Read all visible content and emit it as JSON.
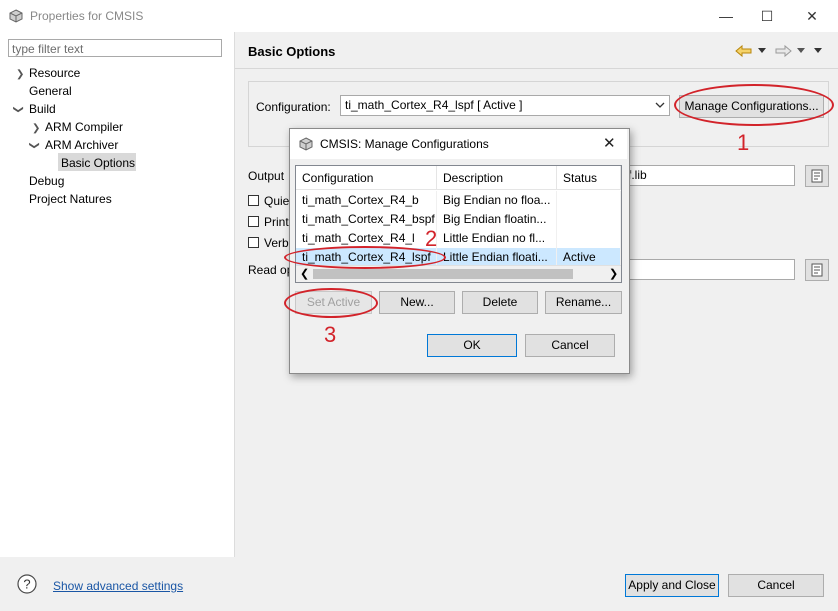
{
  "window": {
    "title": "Properties for CMSIS"
  },
  "left": {
    "filter_placeholder": "type filter text",
    "tree": [
      "Resource",
      "General",
      "Build",
      "ARM Compiler",
      "ARM Archiver",
      "Basic Options",
      "Debug",
      "Project Natures"
    ]
  },
  "right": {
    "page_title": "Basic Options",
    "config_label": "Configuration:",
    "config_value": "ti_math_Cortex_R4_lspf  [ Active ]",
    "manage_button": "Manage Configurations...",
    "output_label": "Output",
    "output_value_tail": "f.lib",
    "checks": [
      "Quie",
      "Print",
      "Verbo"
    ],
    "readop_label": "Read op"
  },
  "dialog": {
    "title": "CMSIS: Manage Configurations",
    "columns": [
      "Configuration",
      "Description",
      "Status"
    ],
    "rows": [
      {
        "config": "ti_math_Cortex_R4_b",
        "desc": "Big Endian no floa...",
        "status": ""
      },
      {
        "config": "ti_math_Cortex_R4_bspf",
        "desc": "Big Endian floatin...",
        "status": ""
      },
      {
        "config": "ti_math_Cortex_R4_l",
        "desc": "Little Endian no fl...",
        "status": ""
      },
      {
        "config": "ti_math_Cortex_R4_lspf",
        "desc": "Little Endian floati...",
        "status": "Active"
      }
    ],
    "buttons": {
      "set_active": "Set Active",
      "new": "New...",
      "delete": "Delete",
      "rename": "Rename...",
      "ok": "OK",
      "cancel": "Cancel"
    }
  },
  "bottom": {
    "advanced_link": "Show advanced settings",
    "apply_close": "Apply and Close",
    "cancel": "Cancel"
  },
  "annotations": {
    "n1": "1",
    "n2": "2",
    "n3": "3"
  },
  "colors": {
    "annotation": "#d2232a",
    "selection": "#cce8ff",
    "link": "#1a56a5"
  }
}
